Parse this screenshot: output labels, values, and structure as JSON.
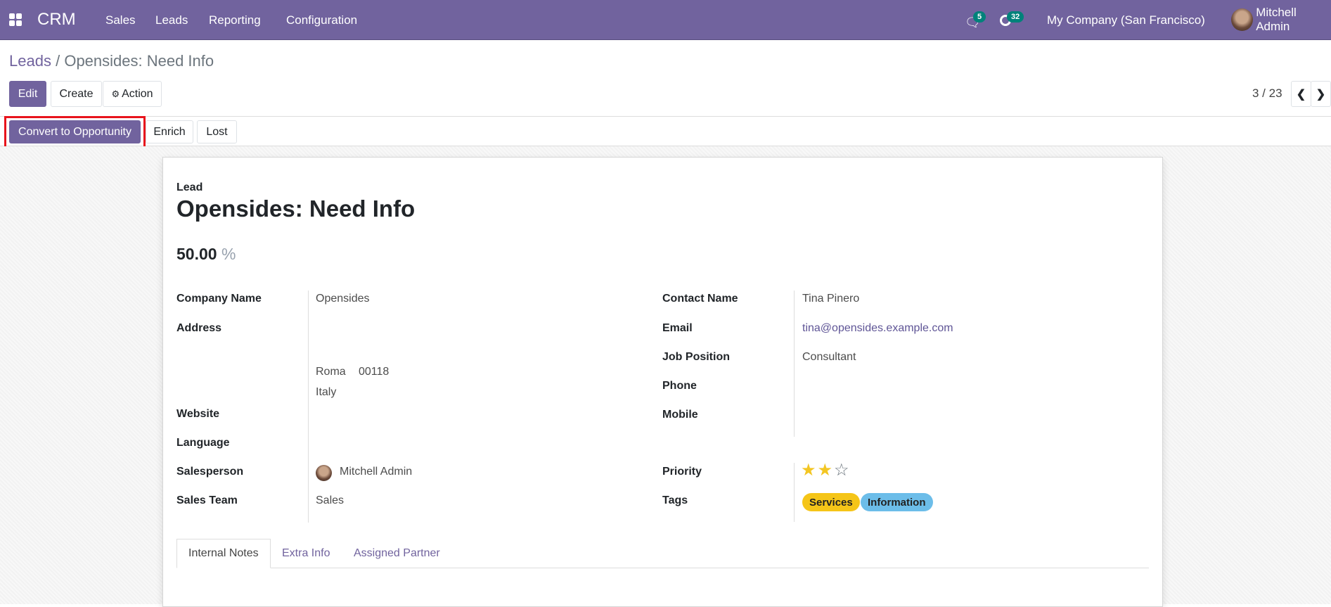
{
  "nav": {
    "app": "CRM",
    "menu": [
      "Sales",
      "Leads",
      "Reporting",
      "Configuration"
    ],
    "messages_count": "5",
    "activities_count": "32",
    "company": "My Company (San Francisco)",
    "user": "Mitchell Admin"
  },
  "breadcrumb": {
    "parent": "Leads",
    "sep": "/",
    "current": "Opensides: Need Info"
  },
  "toolbar": {
    "edit": "Edit",
    "create": "Create",
    "action": "Action",
    "pager": "3 / 23"
  },
  "statusbar": {
    "convert": "Convert to Opportunity",
    "enrich": "Enrich",
    "lost": "Lost"
  },
  "form": {
    "type_label": "Lead",
    "title": "Opensides: Need Info",
    "probability": "50.00",
    "probability_unit": "%",
    "left": {
      "company_label": "Company Name",
      "company": "Opensides",
      "address_label": "Address",
      "city": "Roma",
      "zip": "00118",
      "country": "Italy",
      "website_label": "Website",
      "language_label": "Language",
      "salesperson_label": "Salesperson",
      "salesperson": "Mitchell Admin",
      "team_label": "Sales Team",
      "team": "Sales"
    },
    "right": {
      "contact_label": "Contact Name",
      "contact": "Tina Pinero",
      "email_label": "Email",
      "email": "tina@opensides.example.com",
      "job_label": "Job Position",
      "job": "Consultant",
      "phone_label": "Phone",
      "mobile_label": "Mobile",
      "priority_label": "Priority",
      "priority_stars": 2,
      "priority_max": 3,
      "tags_label": "Tags",
      "tags": [
        {
          "label": "Services",
          "color": "#f5c518"
        },
        {
          "label": "Information",
          "color": "#6cbde9"
        }
      ]
    },
    "tabs": [
      "Internal Notes",
      "Extra Info",
      "Assigned Partner"
    ],
    "active_tab": "Internal Notes"
  },
  "colors": {
    "brand": "#71639e",
    "highlight": "#e8141c"
  }
}
